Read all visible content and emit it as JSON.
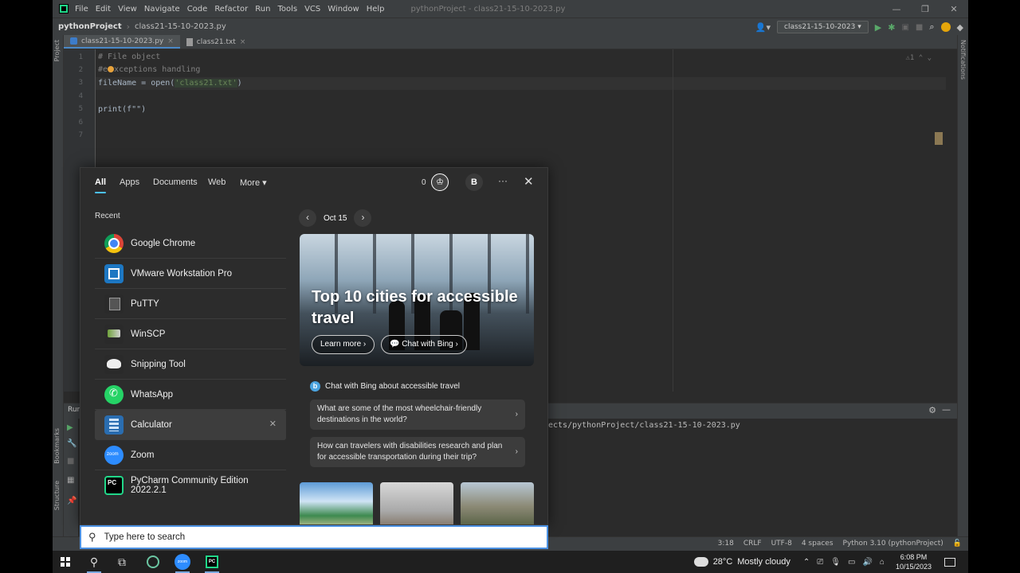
{
  "ide": {
    "menu": [
      "File",
      "Edit",
      "View",
      "Navigate",
      "Code",
      "Refactor",
      "Run",
      "Tools",
      "VCS",
      "Window",
      "Help"
    ],
    "window_title": "pythonProject - class21-15-10-2023.py",
    "nav_project": "pythonProject",
    "nav_file": "class21-15-10-2023.py",
    "run_config": "class21-15-10-2023",
    "tabs": [
      {
        "label": "class21-15-10-2023.py",
        "active": true
      },
      {
        "label": "class21.txt",
        "active": false
      }
    ],
    "side_left": [
      "Project",
      "Bookmarks",
      "Structure"
    ],
    "side_right": "Notifications",
    "line_numbers": [
      "1",
      "2",
      "3",
      "4",
      "5",
      "6",
      "7"
    ],
    "code": {
      "l1": "# File object",
      "l2": "xceptions handling",
      "l2_prefix": "#e",
      "l3_a": "fileName = open(",
      "l3_str": "'class21.txt'",
      "l3_b": ")",
      "l5": "print(f\"\")"
    },
    "inspection": "⚠1",
    "run_label": "Run",
    "run_output_path": "ects/pythonProject/class21-15-10-2023.py",
    "status": [
      "3:18",
      "CRLF",
      "UTF-8",
      "4 spaces",
      "Python 3.10 (pythonProject)"
    ]
  },
  "flyout": {
    "tabs": [
      "All",
      "Apps",
      "Documents",
      "Web",
      "More"
    ],
    "points": "0",
    "avatar_letter": "B",
    "recent_label": "Recent",
    "recent": [
      {
        "name": "Google Chrome",
        "icon": "chrome-icon"
      },
      {
        "name": "VMware Workstation Pro",
        "icon": "vmware-icon"
      },
      {
        "name": "PuTTY",
        "icon": "putty-icon"
      },
      {
        "name": "WinSCP",
        "icon": "winscp-icon"
      },
      {
        "name": "Snipping Tool",
        "icon": "snipping-tool-icon"
      },
      {
        "name": "WhatsApp",
        "icon": "whatsapp-icon"
      },
      {
        "name": "Calculator",
        "icon": "calculator-icon"
      },
      {
        "name": "Zoom",
        "icon": "zoom-icon"
      },
      {
        "name": "PyCharm Community Edition 2022.2.1",
        "icon": "pycharm-icon"
      }
    ],
    "date": "Oct 15",
    "hero_title": "Top 10 cities for accessible travel",
    "hero_learn_more": "Learn more",
    "hero_chat": "Chat with Bing",
    "bing_heading": "Chat with Bing about accessible travel",
    "questions": [
      "What are some of the most wheelchair-friendly destinations in the world?",
      "How can travelers with disabilities research and plan for accessible transportation during their trip?"
    ]
  },
  "search": {
    "placeholder": "Type here to search"
  },
  "taskbar": {
    "weather_temp": "28°C",
    "weather_text": "Mostly cloudy",
    "time": "6:08 PM",
    "date": "10/15/2023"
  },
  "colors": {
    "accent": "#4cc2ff",
    "editor_bg": "#2b2b2b",
    "panel_bg": "#3c3f41",
    "flyout_bg": "#2c2c2c"
  }
}
